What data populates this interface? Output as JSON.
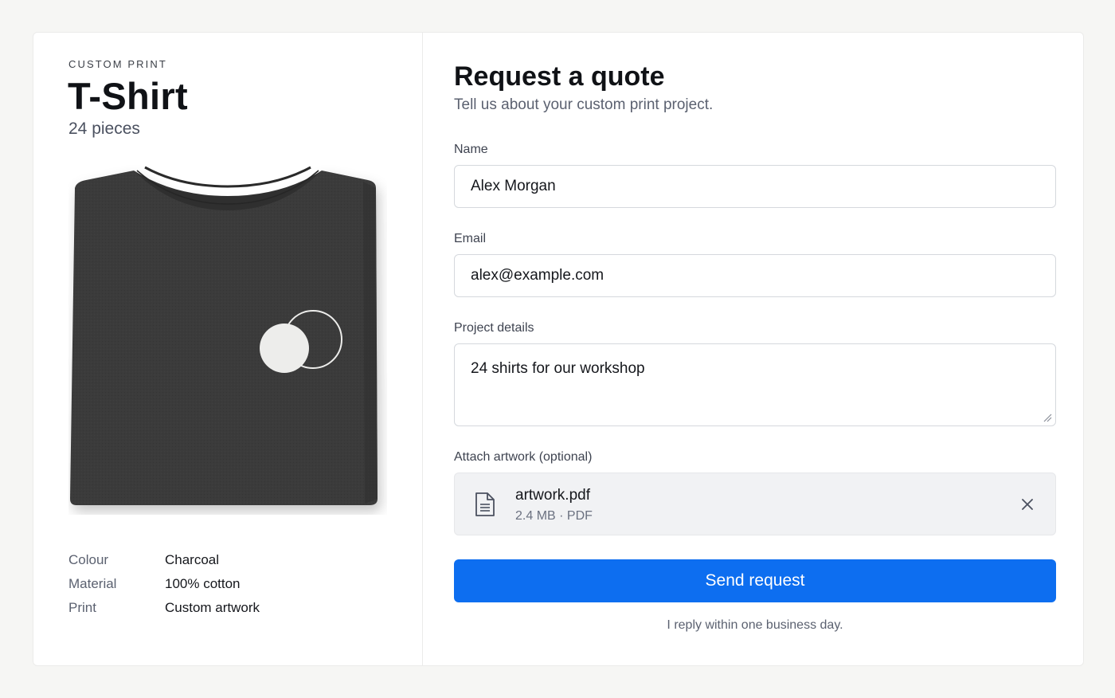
{
  "product": {
    "eyebrow": "CUSTOM PRINT",
    "title": "T-Shirt",
    "quantity": "24 pieces",
    "image_icon": "folded-tshirt-icon",
    "specs": [
      {
        "label": "Colour",
        "value": "Charcoal"
      },
      {
        "label": "Material",
        "value": "100% cotton"
      },
      {
        "label": "Print",
        "value": "Custom artwork"
      }
    ]
  },
  "form": {
    "title": "Request a quote",
    "subtitle": "Tell us about your custom print project.",
    "name": {
      "label": "Name",
      "value": "Alex Morgan"
    },
    "email": {
      "label": "Email",
      "value": "alex@example.com"
    },
    "details": {
      "label": "Project details",
      "value": "24 shirts for our workshop"
    },
    "attachment": {
      "label": "Attach artwork (optional)",
      "file_name": "artwork.pdf",
      "file_meta": "2.4 MB · PDF",
      "icon": "document-icon",
      "remove_icon": "close-icon"
    },
    "submit_label": "Send request",
    "note": "I reply within one business day."
  },
  "colors": {
    "accent": "#0d6ef0",
    "shirt": "#3a3a3a",
    "page_background": "#f6f6f4"
  }
}
